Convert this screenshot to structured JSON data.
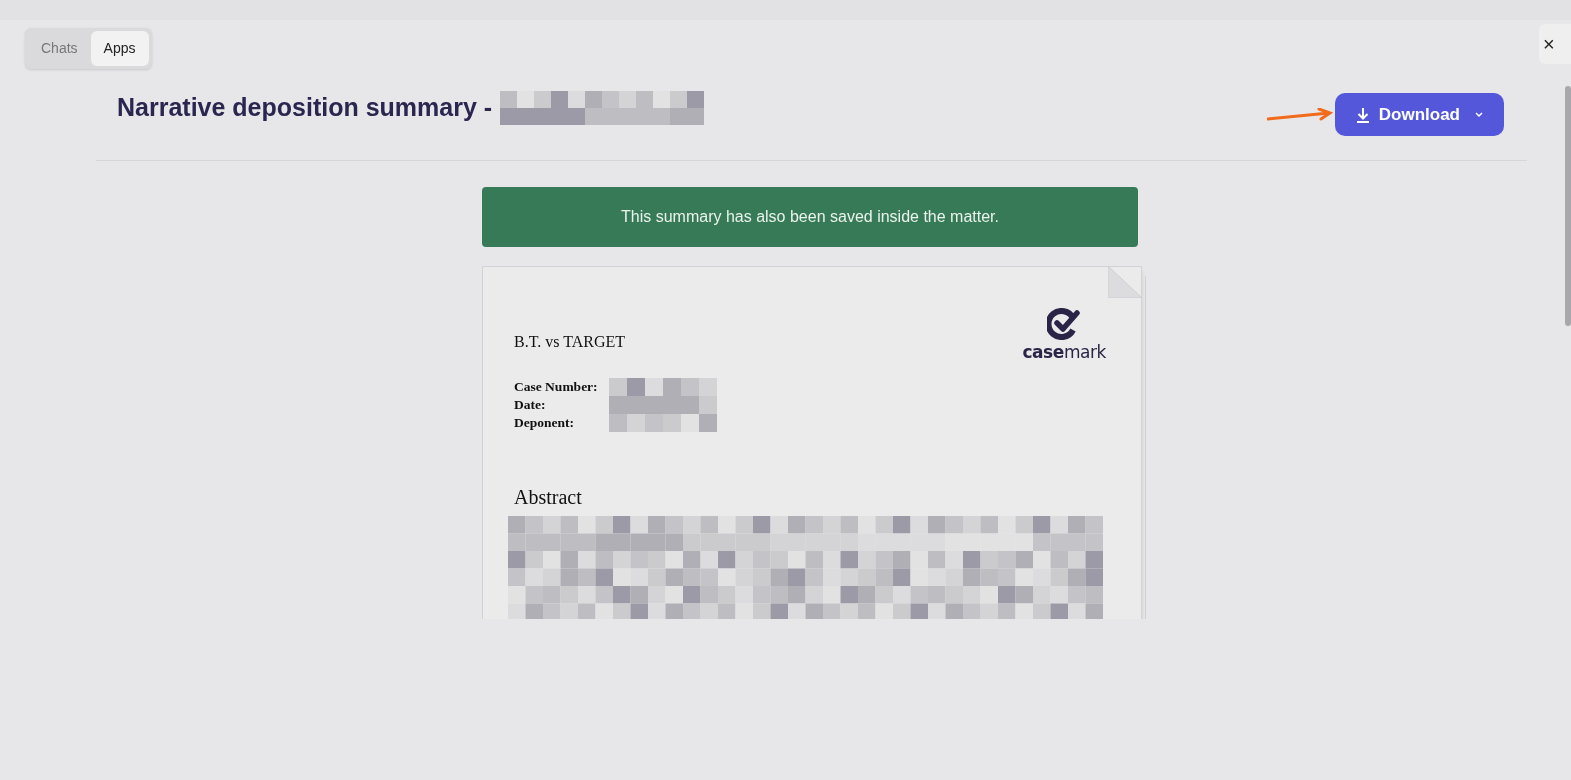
{
  "tabs": [
    {
      "label": "Chats",
      "selected": false
    },
    {
      "label": "Apps",
      "selected": true
    }
  ],
  "close_button": {
    "label": "×"
  },
  "title": "Narrative deposition summary -",
  "download_button": {
    "label": "Download"
  },
  "banner": "This summary has also been saved inside the matter.",
  "document": {
    "case_title": "B.T. vs TARGET",
    "logo": "**case**mark",
    "fields": [
      {
        "label": "Case Number:"
      },
      {
        "label": "Date:"
      },
      {
        "label": "Deponent:"
      }
    ],
    "section_heading": "Abstract"
  }
}
